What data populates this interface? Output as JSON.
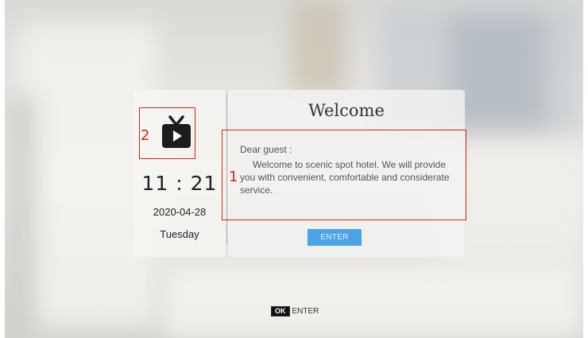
{
  "clock": {
    "time": "11 : 21",
    "date": "2020-04-28",
    "weekday": "Tuesday"
  },
  "welcome_card": {
    "title": "Welcome",
    "greeting": "Dear guest :",
    "message": "Welcome to scenic spot hotel. We will provide you with convenient, comfortable and considerate service.",
    "enter_label": "ENTER"
  },
  "hint": {
    "key": "OK",
    "text": "ENTER"
  },
  "annotations": {
    "marker_1": "1",
    "marker_2": "2"
  },
  "icons": {
    "tv": "tv-play-icon"
  },
  "colors": {
    "accent": "#4aa3e6",
    "annotation": "#e02020"
  }
}
